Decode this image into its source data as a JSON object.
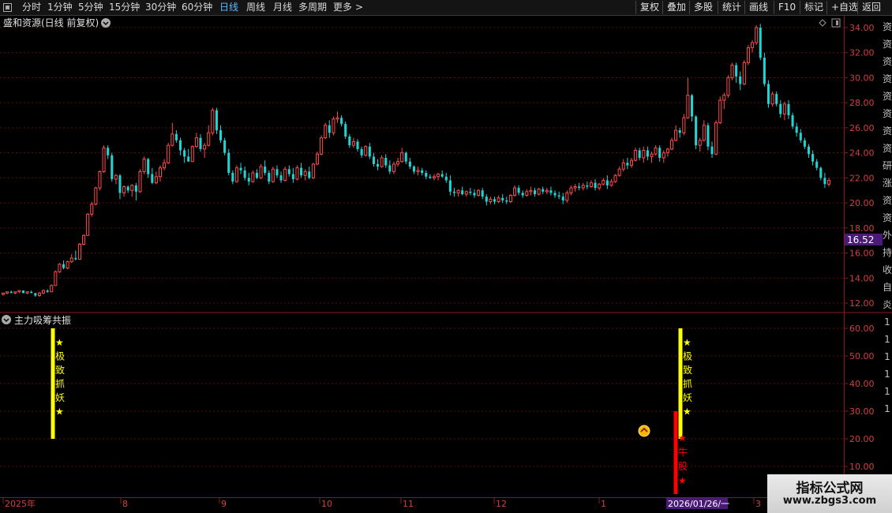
{
  "toolbar": {
    "periods": [
      "分时",
      "1分钟",
      "5分钟",
      "15分钟",
      "30分钟",
      "60分钟",
      "日线",
      "周线",
      "月线",
      "多周期",
      "更多"
    ],
    "active_period": "日线",
    "more_glyph": ">",
    "right_buttons": [
      "复权",
      "叠加",
      "多股",
      "统计",
      "画线",
      "F10",
      "标记",
      "+自选",
      "返回"
    ]
  },
  "main_chart": {
    "title": "盛和资源(日线 前复权)",
    "price_axis": [
      "34.00",
      "32.00",
      "30.00",
      "28.00",
      "26.00",
      "24.00",
      "22.00",
      "20.00",
      "18.00",
      "16.00",
      "14.00",
      "12.00"
    ],
    "current_price_tag": "16.52"
  },
  "indicator": {
    "title": "主力吸筹共振",
    "axis": [
      "60.00",
      "50.00",
      "40.00",
      "30.00",
      "20.00",
      "10.00"
    ],
    "axis_suffix": "1",
    "signal_yellow_chars": [
      "★",
      "极",
      "致",
      "抓",
      "妖",
      "★"
    ],
    "signal_red_chars": [
      "★",
      "牛",
      "股",
      "★"
    ]
  },
  "time_axis": {
    "labels": [
      "2025年",
      "8",
      "9",
      "10",
      "11",
      "12",
      "1",
      "3"
    ],
    "cursor_date": "2026/01/26/一"
  },
  "side_strip": [
    "资",
    "资",
    "资",
    "资",
    "资",
    "资",
    "资",
    "资",
    "研",
    "涨",
    "资",
    "资",
    "外",
    "持",
    "收",
    "自",
    "炎",
    "1",
    "1",
    "1",
    "1",
    "1",
    "1"
  ],
  "watermark": {
    "title": "指标公式网",
    "url": "www.zbgs3.com"
  },
  "colors": {
    "up": "#ff4a4a",
    "down": "#22d3d3",
    "signal_yellow": "#ffff00",
    "signal_red": "#ff0000",
    "tag_bg": "#4a1a7a"
  },
  "chart_data": {
    "type": "candlestick",
    "y_range": [
      11.5,
      35.5
    ],
    "candles": [
      [
        12.7,
        12.8,
        12.6,
        12.8
      ],
      [
        12.8,
        12.9,
        12.7,
        12.9
      ],
      [
        12.9,
        13.0,
        12.8,
        12.8
      ],
      [
        12.8,
        12.9,
        12.7,
        12.9
      ],
      [
        12.9,
        13.0,
        12.8,
        13.0
      ],
      [
        13.0,
        13.0,
        12.8,
        12.8
      ],
      [
        12.8,
        12.9,
        12.7,
        12.9
      ],
      [
        12.9,
        13.0,
        12.8,
        12.8
      ],
      [
        12.8,
        12.8,
        12.5,
        12.6
      ],
      [
        12.6,
        12.9,
        12.5,
        12.8
      ],
      [
        12.8,
        13.1,
        12.7,
        13.0
      ],
      [
        13.0,
        13.1,
        12.8,
        12.9
      ],
      [
        12.9,
        13.5,
        12.9,
        13.4
      ],
      [
        13.4,
        14.6,
        13.4,
        14.5
      ],
      [
        14.5,
        15.2,
        14.4,
        15.1
      ],
      [
        15.1,
        15.4,
        14.7,
        14.8
      ],
      [
        14.8,
        15.4,
        14.7,
        15.3
      ],
      [
        15.3,
        15.9,
        15.2,
        15.6
      ],
      [
        15.6,
        16.2,
        15.4,
        15.5
      ],
      [
        15.5,
        16.8,
        15.5,
        16.7
      ],
      [
        16.7,
        17.5,
        16.6,
        17.4
      ],
      [
        17.4,
        19.2,
        17.4,
        19.1
      ],
      [
        19.1,
        20.1,
        18.9,
        19.9
      ],
      [
        19.9,
        21.3,
        19.8,
        21.2
      ],
      [
        21.2,
        22.6,
        21.0,
        22.5
      ],
      [
        22.5,
        24.6,
        22.4,
        24.4
      ],
      [
        24.4,
        24.6,
        23.5,
        23.8
      ],
      [
        23.8,
        24.0,
        21.7,
        21.9
      ],
      [
        21.9,
        22.3,
        21.5,
        22.2
      ],
      [
        22.2,
        22.3,
        20.3,
        20.8
      ],
      [
        20.8,
        21.4,
        20.5,
        21.3
      ],
      [
        21.3,
        21.4,
        20.8,
        21.0
      ],
      [
        21.0,
        21.5,
        20.5,
        21.4
      ],
      [
        21.4,
        21.6,
        20.2,
        20.9
      ],
      [
        20.9,
        22.7,
        20.8,
        22.5
      ],
      [
        22.5,
        23.7,
        22.3,
        23.5
      ],
      [
        23.5,
        23.6,
        22.0,
        22.3
      ],
      [
        22.3,
        22.8,
        21.5,
        21.6
      ],
      [
        21.6,
        22.5,
        21.5,
        22.1
      ],
      [
        22.1,
        23.0,
        21.7,
        22.8
      ],
      [
        22.8,
        23.5,
        22.6,
        23.2
      ],
      [
        23.2,
        24.8,
        23.1,
        24.6
      ],
      [
        24.6,
        26.4,
        24.5,
        25.5
      ],
      [
        25.5,
        25.8,
        24.8,
        25.0
      ],
      [
        25.0,
        25.2,
        23.8,
        24.2
      ],
      [
        24.2,
        24.4,
        23.2,
        23.7
      ],
      [
        23.7,
        24.3,
        23.3,
        23.3
      ],
      [
        23.3,
        24.6,
        23.3,
        24.5
      ],
      [
        24.5,
        25.6,
        24.4,
        25.2
      ],
      [
        25.2,
        25.5,
        24.1,
        24.3
      ],
      [
        24.3,
        24.8,
        23.6,
        24.6
      ],
      [
        24.6,
        26.2,
        24.5,
        25.6
      ],
      [
        25.6,
        27.6,
        25.4,
        27.4
      ],
      [
        27.4,
        27.6,
        25.5,
        25.8
      ],
      [
        25.8,
        26.2,
        24.8,
        25.0
      ],
      [
        25.0,
        25.2,
        23.8,
        24.0
      ],
      [
        24.0,
        24.3,
        22.2,
        22.4
      ],
      [
        22.4,
        22.6,
        21.5,
        21.7
      ],
      [
        21.7,
        23.0,
        21.6,
        22.8
      ],
      [
        22.8,
        23.2,
        22.3,
        22.6
      ],
      [
        22.6,
        22.9,
        21.8,
        22.0
      ],
      [
        22.0,
        22.4,
        21.4,
        21.7
      ],
      [
        21.7,
        22.6,
        21.6,
        22.4
      ],
      [
        22.4,
        22.7,
        21.9,
        22.0
      ],
      [
        22.0,
        23.1,
        21.9,
        22.9
      ],
      [
        22.9,
        23.4,
        22.2,
        22.4
      ],
      [
        22.4,
        22.6,
        21.5,
        21.7
      ],
      [
        21.7,
        22.9,
        21.6,
        22.7
      ],
      [
        22.7,
        23.0,
        22.0,
        22.2
      ],
      [
        22.2,
        22.5,
        21.6,
        21.8
      ],
      [
        21.8,
        22.9,
        21.7,
        22.7
      ],
      [
        22.7,
        23.0,
        22.1,
        22.3
      ],
      [
        22.3,
        22.8,
        21.6,
        21.9
      ],
      [
        21.9,
        23.0,
        21.8,
        22.8
      ],
      [
        22.8,
        23.2,
        22.0,
        22.2
      ],
      [
        22.2,
        22.7,
        21.8,
        22.5
      ],
      [
        22.5,
        22.9,
        21.9,
        22.0
      ],
      [
        22.0,
        23.2,
        21.9,
        23.1
      ],
      [
        23.1,
        24.1,
        23.0,
        23.9
      ],
      [
        23.9,
        25.4,
        23.8,
        25.2
      ],
      [
        25.2,
        26.4,
        25.1,
        26.2
      ],
      [
        26.2,
        26.6,
        25.2,
        25.6
      ],
      [
        25.6,
        26.9,
        25.4,
        26.7
      ],
      [
        26.7,
        27.3,
        26.4,
        26.8
      ],
      [
        26.8,
        27.0,
        26.1,
        26.3
      ],
      [
        26.3,
        26.5,
        25.1,
        25.3
      ],
      [
        25.3,
        25.5,
        24.4,
        24.6
      ],
      [
        24.6,
        25.2,
        24.4,
        24.9
      ],
      [
        24.9,
        25.1,
        24.1,
        24.3
      ],
      [
        24.3,
        24.5,
        23.6,
        23.8
      ],
      [
        23.8,
        24.6,
        23.7,
        24.5
      ],
      [
        24.5,
        24.8,
        23.5,
        23.7
      ],
      [
        23.7,
        24.0,
        22.9,
        23.1
      ],
      [
        23.1,
        23.5,
        22.6,
        22.9
      ],
      [
        22.9,
        23.8,
        22.8,
        23.6
      ],
      [
        23.6,
        23.9,
        22.8,
        23.0
      ],
      [
        23.0,
        23.4,
        22.3,
        22.5
      ],
      [
        22.5,
        23.3,
        22.3,
        23.1
      ],
      [
        23.1,
        23.6,
        22.9,
        23.3
      ],
      [
        23.3,
        24.4,
        23.2,
        24.0
      ],
      [
        24.0,
        24.1,
        23.1,
        23.3
      ],
      [
        23.3,
        23.6,
        22.7,
        22.9
      ],
      [
        22.9,
        23.0,
        22.3,
        22.5
      ],
      [
        22.5,
        22.9,
        22.2,
        22.6
      ],
      [
        22.6,
        22.8,
        22.2,
        22.4
      ],
      [
        22.4,
        22.6,
        21.9,
        22.1
      ],
      [
        22.1,
        22.3,
        21.9,
        22.0
      ],
      [
        22.0,
        22.3,
        21.8,
        22.1
      ],
      [
        22.1,
        22.4,
        21.8,
        22.3
      ],
      [
        22.3,
        22.6,
        22.0,
        22.1
      ],
      [
        22.1,
        22.4,
        21.6,
        21.8
      ],
      [
        21.8,
        22.2,
        20.6,
        20.9
      ],
      [
        20.9,
        21.2,
        20.5,
        20.8
      ],
      [
        20.8,
        21.1,
        20.5,
        21.0
      ],
      [
        21.0,
        21.3,
        20.6,
        20.7
      ],
      [
        20.7,
        21.0,
        20.5,
        20.9
      ],
      [
        20.9,
        21.2,
        20.6,
        20.8
      ],
      [
        20.8,
        21.1,
        20.4,
        20.6
      ],
      [
        20.6,
        21.1,
        20.5,
        21.0
      ],
      [
        21.0,
        21.2,
        20.3,
        20.5
      ],
      [
        20.5,
        20.7,
        19.8,
        20.1
      ],
      [
        20.1,
        20.5,
        19.9,
        20.3
      ],
      [
        20.3,
        20.5,
        19.9,
        20.1
      ],
      [
        20.1,
        20.6,
        20.0,
        20.4
      ],
      [
        20.4,
        20.7,
        20.0,
        20.2
      ],
      [
        20.2,
        20.5,
        19.9,
        20.1
      ],
      [
        20.1,
        20.7,
        20.0,
        20.6
      ],
      [
        20.6,
        21.4,
        20.5,
        21.2
      ],
      [
        21.2,
        21.4,
        20.6,
        20.8
      ],
      [
        20.8,
        21.0,
        20.4,
        20.6
      ],
      [
        20.6,
        21.1,
        20.5,
        20.9
      ],
      [
        20.9,
        21.3,
        20.6,
        21.0
      ],
      [
        21.0,
        21.2,
        20.5,
        20.7
      ],
      [
        20.7,
        21.2,
        20.6,
        21.1
      ],
      [
        21.1,
        21.3,
        20.7,
        20.9
      ],
      [
        20.9,
        21.2,
        20.7,
        21.0
      ],
      [
        21.0,
        21.3,
        20.6,
        20.8
      ],
      [
        20.8,
        21.0,
        20.4,
        20.6
      ],
      [
        20.6,
        20.9,
        20.3,
        20.5
      ],
      [
        20.5,
        20.8,
        19.9,
        20.2
      ],
      [
        20.2,
        21.0,
        20.0,
        20.8
      ],
      [
        20.8,
        21.4,
        20.6,
        21.2
      ],
      [
        21.2,
        21.5,
        20.9,
        21.3
      ],
      [
        21.3,
        21.6,
        21.0,
        21.2
      ],
      [
        21.2,
        21.6,
        21.0,
        21.4
      ],
      [
        21.4,
        21.7,
        21.1,
        21.3
      ],
      [
        21.3,
        21.8,
        21.2,
        21.6
      ],
      [
        21.6,
        21.9,
        21.0,
        21.2
      ],
      [
        21.2,
        21.6,
        21.0,
        21.5
      ],
      [
        21.5,
        22.0,
        21.4,
        21.8
      ],
      [
        21.8,
        22.2,
        21.1,
        21.4
      ],
      [
        21.4,
        21.9,
        21.3,
        21.7
      ],
      [
        21.7,
        22.3,
        21.6,
        22.2
      ],
      [
        22.2,
        22.9,
        22.1,
        22.7
      ],
      [
        22.7,
        23.5,
        22.5,
        23.2
      ],
      [
        23.2,
        23.6,
        22.7,
        23.0
      ],
      [
        23.0,
        23.6,
        22.8,
        23.4
      ],
      [
        23.4,
        24.4,
        23.3,
        24.2
      ],
      [
        24.2,
        24.4,
        23.4,
        23.6
      ],
      [
        23.6,
        24.5,
        23.2,
        24.2
      ],
      [
        24.2,
        24.5,
        23.4,
        23.7
      ],
      [
        23.7,
        24.1,
        23.2,
        23.9
      ],
      [
        23.9,
        24.6,
        23.8,
        24.4
      ],
      [
        24.4,
        24.6,
        23.3,
        23.6
      ],
      [
        23.6,
        24.2,
        23.2,
        24.0
      ],
      [
        24.0,
        24.4,
        23.7,
        24.3
      ],
      [
        24.3,
        25.2,
        24.2,
        25.0
      ],
      [
        25.0,
        26.2,
        24.9,
        25.8
      ],
      [
        25.8,
        26.0,
        25.2,
        25.6
      ],
      [
        25.6,
        27.1,
        25.4,
        26.8
      ],
      [
        26.8,
        30.0,
        26.7,
        28.6
      ],
      [
        28.6,
        28.7,
        26.5,
        26.9
      ],
      [
        26.9,
        27.0,
        24.3,
        24.6
      ],
      [
        24.6,
        25.2,
        24.1,
        25.0
      ],
      [
        25.0,
        26.6,
        24.9,
        26.2
      ],
      [
        26.2,
        26.4,
        24.2,
        24.5
      ],
      [
        24.5,
        24.9,
        23.6,
        23.9
      ],
      [
        23.9,
        26.6,
        23.8,
        26.4
      ],
      [
        26.4,
        28.5,
        26.3,
        28.2
      ],
      [
        28.2,
        28.8,
        27.5,
        28.6
      ],
      [
        28.6,
        30.2,
        28.4,
        30.0
      ],
      [
        30.0,
        31.2,
        29.8,
        31.0
      ],
      [
        31.0,
        31.2,
        29.6,
        30.1
      ],
      [
        30.1,
        30.5,
        29.0,
        29.5
      ],
      [
        29.5,
        31.4,
        29.4,
        31.2
      ],
      [
        31.2,
        32.6,
        31.0,
        32.4
      ],
      [
        32.4,
        33.0,
        32.0,
        32.8
      ],
      [
        32.8,
        34.2,
        32.6,
        34.0
      ],
      [
        34.0,
        34.3,
        31.4,
        31.6
      ],
      [
        31.6,
        32.0,
        29.3,
        29.5
      ],
      [
        29.5,
        29.8,
        27.6,
        27.9
      ],
      [
        27.9,
        28.9,
        27.7,
        28.7
      ],
      [
        28.7,
        28.9,
        27.7,
        27.9
      ],
      [
        27.9,
        28.2,
        26.8,
        27.1
      ],
      [
        27.1,
        28.1,
        26.6,
        27.9
      ],
      [
        27.9,
        28.2,
        26.7,
        27.0
      ],
      [
        27.0,
        27.2,
        25.9,
        26.1
      ],
      [
        26.1,
        26.4,
        25.3,
        25.6
      ],
      [
        25.6,
        25.9,
        24.8,
        25.0
      ],
      [
        25.0,
        25.2,
        24.3,
        24.5
      ],
      [
        24.5,
        24.7,
        23.6,
        23.9
      ],
      [
        23.9,
        24.2,
        23.0,
        23.3
      ],
      [
        23.3,
        23.5,
        22.6,
        22.8
      ],
      [
        22.8,
        22.9,
        21.8,
        22.0
      ],
      [
        22.0,
        22.4,
        21.2,
        21.5
      ],
      [
        21.5,
        22.0,
        21.3,
        21.8
      ]
    ],
    "indicator_signals": [
      {
        "type": "极致抓妖",
        "range": [
          20,
          60
        ]
      },
      {
        "type": "极致抓妖",
        "range": [
          20,
          60
        ]
      },
      {
        "type": "牛股",
        "range": [
          0,
          30
        ]
      }
    ]
  }
}
